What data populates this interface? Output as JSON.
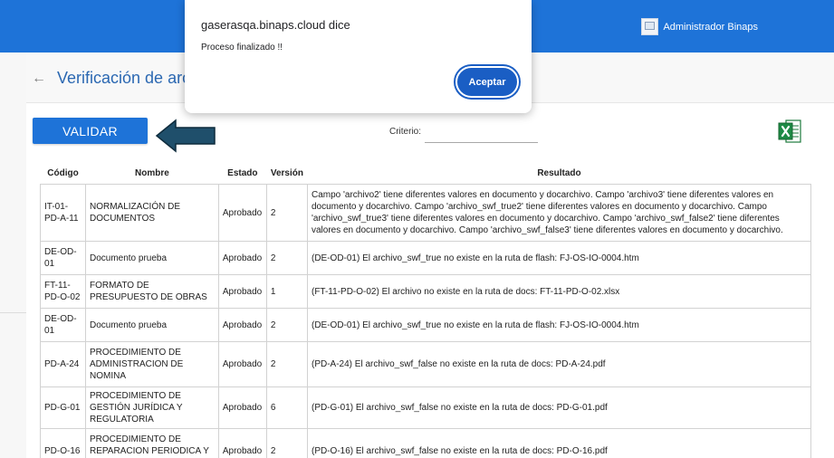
{
  "topbar": {
    "user_name": "Administrador Binaps",
    "brand_color": "#1e73d8"
  },
  "page": {
    "title": "Verificación de archivos"
  },
  "toolbar": {
    "validate_label": "VALIDAR",
    "criterio_label": "Criterio:",
    "criterio_value": ""
  },
  "table": {
    "headers": {
      "codigo": "Código",
      "nombre": "Nombre",
      "estado": "Estado",
      "version": "Versión",
      "resultado": "Resultado"
    },
    "rows": [
      {
        "codigo": "IT-01-PD-A-11",
        "nombre": "NORMALIZACIÓN DE DOCUMENTOS",
        "estado": "Aprobado",
        "version": "2",
        "resultado": "Campo 'archivo2' tiene diferentes valores en documento y docarchivo. Campo 'archivo3' tiene diferentes valores en documento y docarchivo. Campo 'archivo_swf_true2' tiene diferentes valores en documento y docarchivo. Campo 'archivo_swf_true3' tiene diferentes valores en documento y docarchivo. Campo 'archivo_swf_false2' tiene diferentes valores en documento y docarchivo. Campo 'archivo_swf_false3' tiene diferentes valores en documento y docarchivo."
      },
      {
        "codigo": "DE-OD-01",
        "nombre": "Documento prueba",
        "estado": "Aprobado",
        "version": "2",
        "resultado": "(DE-OD-01) El archivo_swf_true no existe en la ruta de flash: FJ-OS-IO-0004.htm"
      },
      {
        "codigo": "FT-11-PD-O-02",
        "nombre": "FORMATO DE PRESUPUESTO DE OBRAS",
        "estado": "Aprobado",
        "version": "1",
        "resultado": "(FT-11-PD-O-02) El archivo no existe en la ruta de docs: FT-11-PD-O-02.xlsx"
      },
      {
        "codigo": "DE-OD-01",
        "nombre": "Documento prueba",
        "estado": "Aprobado",
        "version": "2",
        "resultado": "(DE-OD-01) El archivo_swf_true no existe en la ruta de flash: FJ-OS-IO-0004.htm"
      },
      {
        "codigo": "PD-A-24",
        "nombre": "PROCEDIMIENTO DE ADMINISTRACION DE NOMINA",
        "estado": "Aprobado",
        "version": "2",
        "resultado": "(PD-A-24) El archivo_swf_false no existe en la ruta de docs: PD-A-24.pdf"
      },
      {
        "codigo": "PD-G-01",
        "nombre": "PROCEDIMIENTO DE GESTIÓN JURÍDICA Y REGULATORIA",
        "estado": "Aprobado",
        "version": "6",
        "resultado": "(PD-G-01) El archivo_swf_false no existe en la ruta de docs: PD-G-01.pdf"
      },
      {
        "codigo": "PD-O-16",
        "nombre": "PROCEDIMIENTO DE REPARACION PERIODICA Y SERVICIOS ASOCIADOS",
        "estado": "Aprobado",
        "version": "2",
        "resultado": "(PD-O-16) El archivo_swf_false no existe en la ruta de docs: PD-O-16.pdf"
      }
    ]
  },
  "dialog": {
    "title": "gaserasqa.binaps.cloud dice",
    "message": "Proceso finalizado !!",
    "accept_label": "Aceptar"
  },
  "icons": {
    "back": "back-arrow-icon",
    "excel": "excel-export-icon",
    "avatar": "broken-image-icon",
    "pointer": "left-arrow-pointer-icon"
  }
}
